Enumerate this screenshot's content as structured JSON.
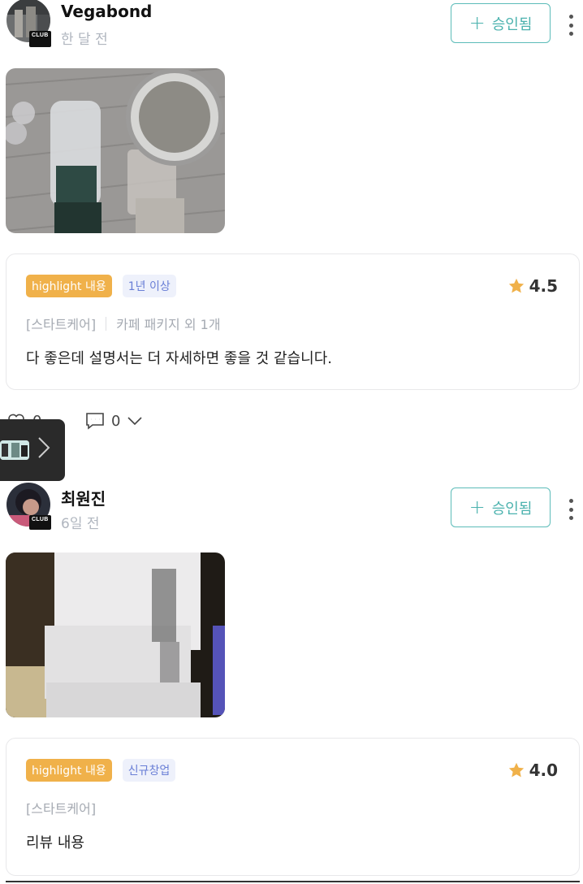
{
  "posts": [
    {
      "author": "Vegabond",
      "time": "한 달 전",
      "approve_label": "승인됨",
      "tags": [
        "highlight 내용",
        "1년 이상"
      ],
      "rating": "4.5",
      "category": "[스타트케어]",
      "package": "카페 패키지 외 1개",
      "body": "다 좋은데 설명서는 더 자세하면 좋을 것 같습니다.",
      "likes": "0",
      "comments": "0"
    },
    {
      "author": "최원진",
      "time": "6일 전",
      "approve_label": "승인됨",
      "tags": [
        "highlight 내용",
        "신규창업"
      ],
      "rating": "4.0",
      "category": "[스타트케어]",
      "body": "리뷰 내용"
    }
  ],
  "icons": {
    "club_badge": "CLUB",
    "star_color": "#f0b14a",
    "accent": "#4bb2ae"
  }
}
